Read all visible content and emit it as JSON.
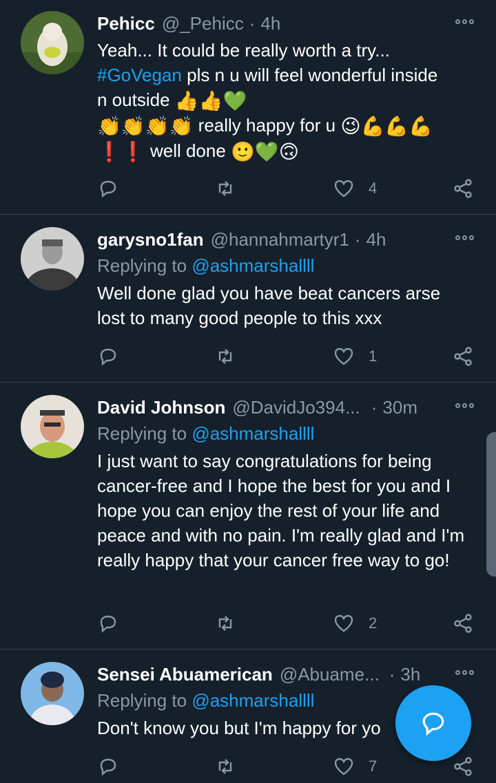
{
  "tweets": [
    {
      "name": "Pehicc",
      "handle": "@_Pehicc",
      "time": "4h",
      "reply_prefix": "",
      "reply_to": "",
      "body_line1": "Yeah... It could be really worth a try...",
      "hashtag": "#GoVegan",
      "body_line2_rest": " pls n u will feel wonderful inside",
      "body_line3": "n outside ",
      "body_line4": " really happy for u ",
      "body_line5": " well done ",
      "likes": "4",
      "avatar_colors": [
        "#5a7a3a",
        "#e8e2d6"
      ]
    },
    {
      "name": "garysno1fan",
      "handle": "@hannahmartyr1",
      "time": "4h",
      "reply_prefix": "Replying to ",
      "reply_to": "@ashmarshallll",
      "body": "Well done glad you have beat cancers arse lost to many good people to this xxx",
      "likes": "1"
    },
    {
      "name": "David Johnson",
      "handle": "@DavidJo394...",
      "time": "30m",
      "reply_prefix": "Replying to ",
      "reply_to": "@ashmarshallll",
      "body": "I just want to say congratulations for being cancer-free and I hope the best for you and I hope you can enjoy the rest of your life and peace and with no pain. I'm really glad and I'm really happy that your cancer free way to go!",
      "likes": "2"
    },
    {
      "name": "Sensei Abuamerican",
      "handle": "@Abuame...",
      "time": "3h",
      "reply_prefix": "Replying to ",
      "reply_to": "@ashmarshallll",
      "body": "Don't know you but I'm happy for yo",
      "likes": "7"
    }
  ],
  "icons": {
    "reply": "reply-icon",
    "retweet": "retweet-icon",
    "like": "heart-icon",
    "share": "share-icon",
    "more": "more-options-icon",
    "compose": "compose-reply-icon"
  },
  "colors": {
    "background": "#15202b",
    "accent": "#1da1f2",
    "muted": "#8899a6",
    "divider": "#38444d"
  }
}
